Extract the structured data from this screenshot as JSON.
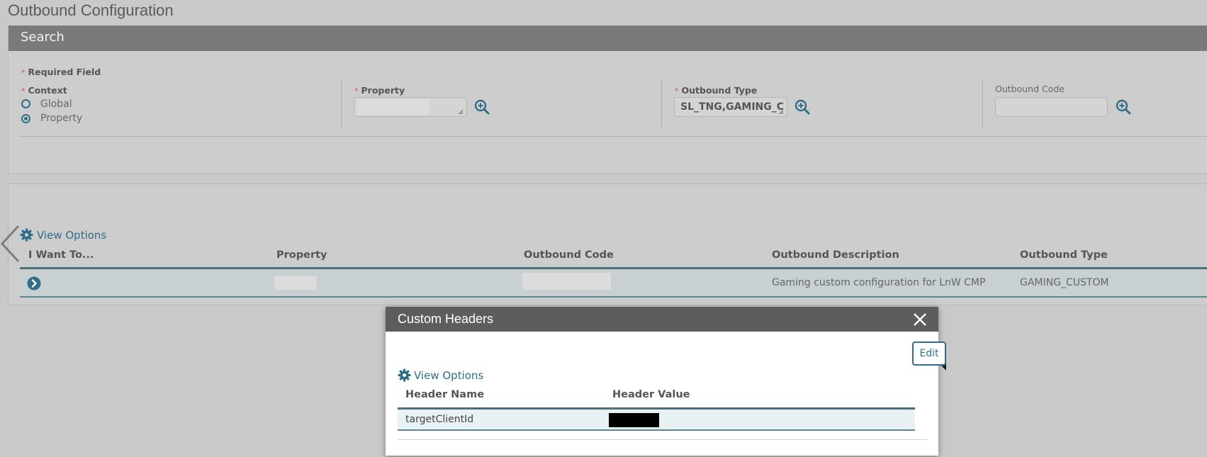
{
  "page": {
    "title": "Outbound Configuration"
  },
  "search": {
    "header": "Search",
    "required_note": "Required Field",
    "context_label": "Context",
    "context_options": [
      "Global",
      "Property"
    ],
    "context_selected": "Property",
    "property_label": "Property",
    "property_value": "",
    "outbound_type_label": "Outbound Type",
    "outbound_type_value": "SL_TNG,GAMING_C",
    "outbound_code_label": "Outbound Code",
    "outbound_code_value": ""
  },
  "results": {
    "view_options": "View Options",
    "columns": [
      "I Want To...",
      "Property",
      "Outbound Code",
      "Outbound Description",
      "Outbound Type"
    ],
    "rows": [
      {
        "property": "",
        "outbound_code": "",
        "description": "Gaming custom configuration for LnW CMP",
        "type": "GAMING_CUSTOM"
      }
    ]
  },
  "modal": {
    "title": "Custom Headers",
    "edit_label": "Edit",
    "view_options": "View Options",
    "columns": [
      "Header Name",
      "Header Value"
    ],
    "rows": [
      {
        "name": "targetClientId",
        "value": ""
      }
    ]
  },
  "icons": {
    "lookup": "search-plus-icon",
    "gear": "gear-icon",
    "close": "close-icon",
    "row_action": "arrow-right-circle-icon",
    "back": "chevron-left-icon"
  },
  "colors": {
    "accent": "#2f6e86",
    "required": "#c4622d",
    "header_bg": "#7a7a7a",
    "modal_header": "#5d5d5d"
  }
}
